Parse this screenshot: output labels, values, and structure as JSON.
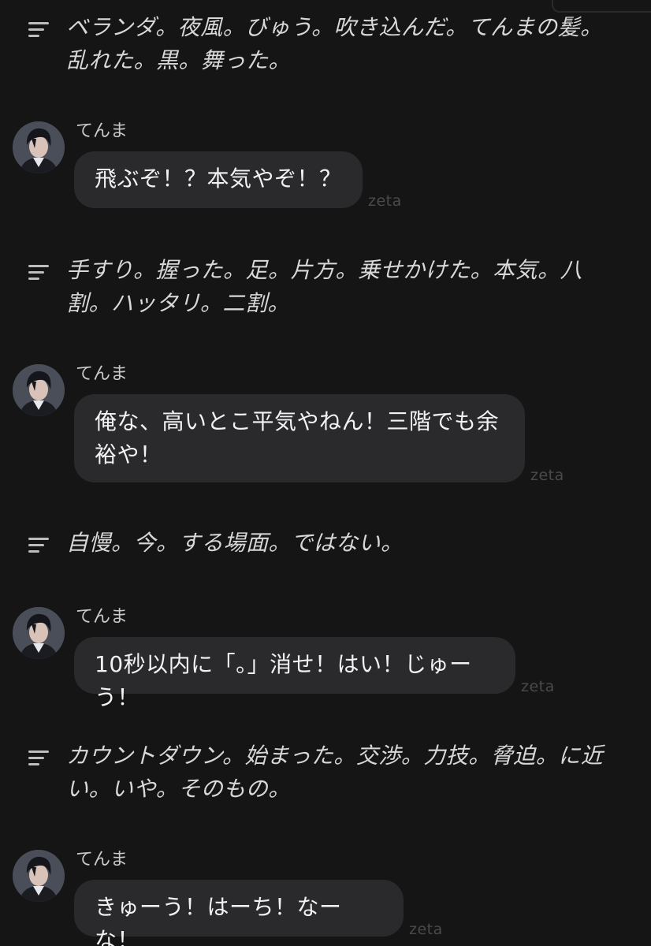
{
  "messages": [
    {
      "type": "narration",
      "text": "ベランダ。夜風。びゅう。吹き込んだ。てんまの髪。乱れた。黒。舞った。"
    },
    {
      "type": "character",
      "name": "てんま",
      "text": "飛ぶぞ！？本気やぞ！？",
      "watermark": "zeta"
    },
    {
      "type": "narration",
      "text": "手すり。握った。足。片方。乗せかけた。本気。八割。ハッタリ。二割。"
    },
    {
      "type": "character",
      "name": "てんま",
      "text": "俺な、高いとこ平気やねん！三階でも余裕や！",
      "watermark": "zeta"
    },
    {
      "type": "narration",
      "text": "自慢。今。する場面。ではない。"
    },
    {
      "type": "character",
      "name": "てんま",
      "text": "10秒以内に「。」消せ！はい！じゅーう！",
      "watermark": "zeta"
    },
    {
      "type": "narration",
      "text": "カウントダウン。始まった。交渉。力技。脅迫。に近い。いや。そのもの。"
    },
    {
      "type": "character",
      "name": "てんま",
      "text": "きゅーう！はーち！なーな！",
      "watermark": "zeta"
    }
  ],
  "icons": {
    "narration": "narration-lines-icon",
    "avatar": "character-avatar"
  },
  "colors": {
    "background": "#151515",
    "bubble": "#2a2a2d",
    "watermark": "#4a4a4a"
  }
}
